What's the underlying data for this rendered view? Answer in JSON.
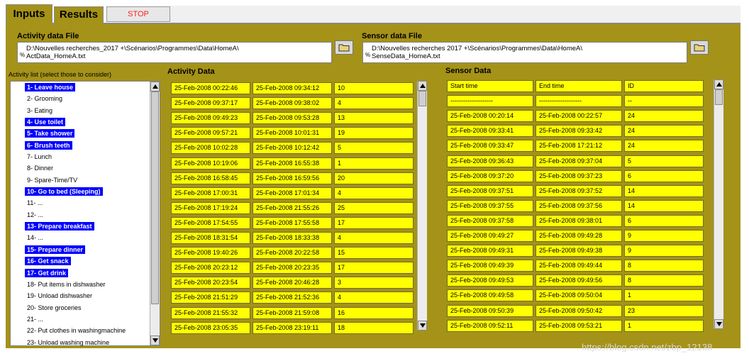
{
  "tabs": [
    {
      "label": "Inputs",
      "active": true
    },
    {
      "label": "Results",
      "active": false
    }
  ],
  "stop_label": "STOP",
  "activity_file": {
    "label": "Activity data File",
    "path_line1": "D:\\Nouvelles recherches_2017 +\\Scénarios\\Programmes\\Data\\HomeA\\",
    "path_line2": "ActData_HomeA.txt"
  },
  "sensor_file": {
    "label": "Sensor data File",
    "path_line1": "D:\\Nouvelles recherches 2017 +\\Scénarios\\Programmes\\Data\\HomeA\\",
    "path_line2": "SenseData_HomeA.txt"
  },
  "activity_list": {
    "label": "Activity list (select those to consider)",
    "items": [
      {
        "label": "1- Leave house",
        "selected": true
      },
      {
        "label": "2- Grooming",
        "selected": false
      },
      {
        "label": "3- Eating",
        "selected": false
      },
      {
        "label": "4- Use toilet",
        "selected": true
      },
      {
        "label": "5- Take shower",
        "selected": true
      },
      {
        "label": "6- Brush teeth",
        "selected": true
      },
      {
        "label": "7- Lunch",
        "selected": false
      },
      {
        "label": "8- Dinner",
        "selected": false
      },
      {
        "label": "9- Spare-Time/TV",
        "selected": false
      },
      {
        "label": "10- Go to bed (Sleeping)",
        "selected": true
      },
      {
        "label": "11- ...",
        "selected": false
      },
      {
        "label": "12- ...",
        "selected": false
      },
      {
        "label": "13- Prepare breakfast",
        "selected": true
      },
      {
        "label": "14- ...",
        "selected": false
      },
      {
        "label": "15- Prepare dinner",
        "selected": true
      },
      {
        "label": "16- Get snack",
        "selected": true
      },
      {
        "label": "17- Get drink",
        "selected": true
      },
      {
        "label": "18- Put items in dishwasher",
        "selected": false
      },
      {
        "label": "19- Unload dishwasher",
        "selected": false
      },
      {
        "label": "20- Store groceries",
        "selected": false
      },
      {
        "label": "21- ...",
        "selected": false
      },
      {
        "label": "22- Put clothes in washingmachine",
        "selected": false
      },
      {
        "label": "23- Unload washing machine",
        "selected": false
      }
    ]
  },
  "activity_data": {
    "label": "Activity Data",
    "rows": [
      [
        "25-Feb-2008 00:22:46",
        "25-Feb-2008 09:34:12",
        "10"
      ],
      [
        "25-Feb-2008 09:37:17",
        "25-Feb-2008 09:38:02",
        "4"
      ],
      [
        "25-Feb-2008 09:49:23",
        "25-Feb-2008 09:53:28",
        "13"
      ],
      [
        "25-Feb-2008 09:57:21",
        "25-Feb-2008 10:01:31",
        "19"
      ],
      [
        "25-Feb-2008 10:02:28",
        "25-Feb-2008 10:12:42",
        "5"
      ],
      [
        "25-Feb-2008 10:19:06",
        "25-Feb-2008 16:55:38",
        "1"
      ],
      [
        "25-Feb-2008 16:58:45",
        "25-Feb-2008 16:59:56",
        "20"
      ],
      [
        "25-Feb-2008 17:00:31",
        "25-Feb-2008 17:01:34",
        "4"
      ],
      [
        "25-Feb-2008 17:19:24",
        "25-Feb-2008 21:55:26",
        "25"
      ],
      [
        "25-Feb-2008 17:54:55",
        "25-Feb-2008 17:55:58",
        "17"
      ],
      [
        "25-Feb-2008 18:31:54",
        "25-Feb-2008 18:33:38",
        "4"
      ],
      [
        "25-Feb-2008 19:40:26",
        "25-Feb-2008 20:22:58",
        "15"
      ],
      [
        "25-Feb-2008 20:23:12",
        "25-Feb-2008 20:23:35",
        "17"
      ],
      [
        "25-Feb-2008 20:23:54",
        "25-Feb-2008 20:46:28",
        "3"
      ],
      [
        "25-Feb-2008 21:51:29",
        "25-Feb-2008 21:52:36",
        "4"
      ],
      [
        "25-Feb-2008 21:55:32",
        "25-Feb-2008 21:59:08",
        "16"
      ],
      [
        "25-Feb-2008 23:05:35",
        "25-Feb-2008 23:19:11",
        "18"
      ]
    ]
  },
  "sensor_data": {
    "label": "Sensor Data",
    "rows": [
      [
        "Start time",
        "End time",
        "ID"
      ],
      [
        "--------------------",
        "--------------------",
        "--"
      ],
      [
        "25-Feb-2008 00:20:14",
        "25-Feb-2008 00:22:57",
        "24"
      ],
      [
        "25-Feb-2008 09:33:41",
        "25-Feb-2008 09:33:42",
        "24"
      ],
      [
        "25-Feb-2008 09:33:47",
        "25-Feb-2008 17:21:12",
        "24"
      ],
      [
        "25-Feb-2008 09:36:43",
        "25-Feb-2008 09:37:04",
        "5"
      ],
      [
        "25-Feb-2008 09:37:20",
        "25-Feb-2008 09:37:23",
        "6"
      ],
      [
        "25-Feb-2008 09:37:51",
        "25-Feb-2008 09:37:52",
        "14"
      ],
      [
        "25-Feb-2008 09:37:55",
        "25-Feb-2008 09:37:56",
        "14"
      ],
      [
        "25-Feb-2008 09:37:58",
        "25-Feb-2008 09:38:01",
        "6"
      ],
      [
        "25-Feb-2008 09:49:27",
        "25-Feb-2008 09:49:28",
        "9"
      ],
      [
        "25-Feb-2008 09:49:31",
        "25-Feb-2008 09:49:38",
        "9"
      ],
      [
        "25-Feb-2008 09:49:39",
        "25-Feb-2008 09:49:44",
        "8"
      ],
      [
        "25-Feb-2008 09:49:53",
        "25-Feb-2008 09:49:56",
        "8"
      ],
      [
        "25-Feb-2008 09:49:58",
        "25-Feb-2008 09:50:04",
        "1"
      ],
      [
        "25-Feb-2008 09:50:39",
        "25-Feb-2008 09:50:42",
        "23"
      ],
      [
        "25-Feb-2008 09:52:11",
        "25-Feb-2008 09:53:21",
        "1"
      ]
    ]
  },
  "watermark": "https://blog.csdn.net/zbp_12138",
  "colors": {
    "panel": "#a59218",
    "cell": "#ffff00",
    "selection": "#0000ff",
    "stop_text": "#ff1e1e"
  }
}
